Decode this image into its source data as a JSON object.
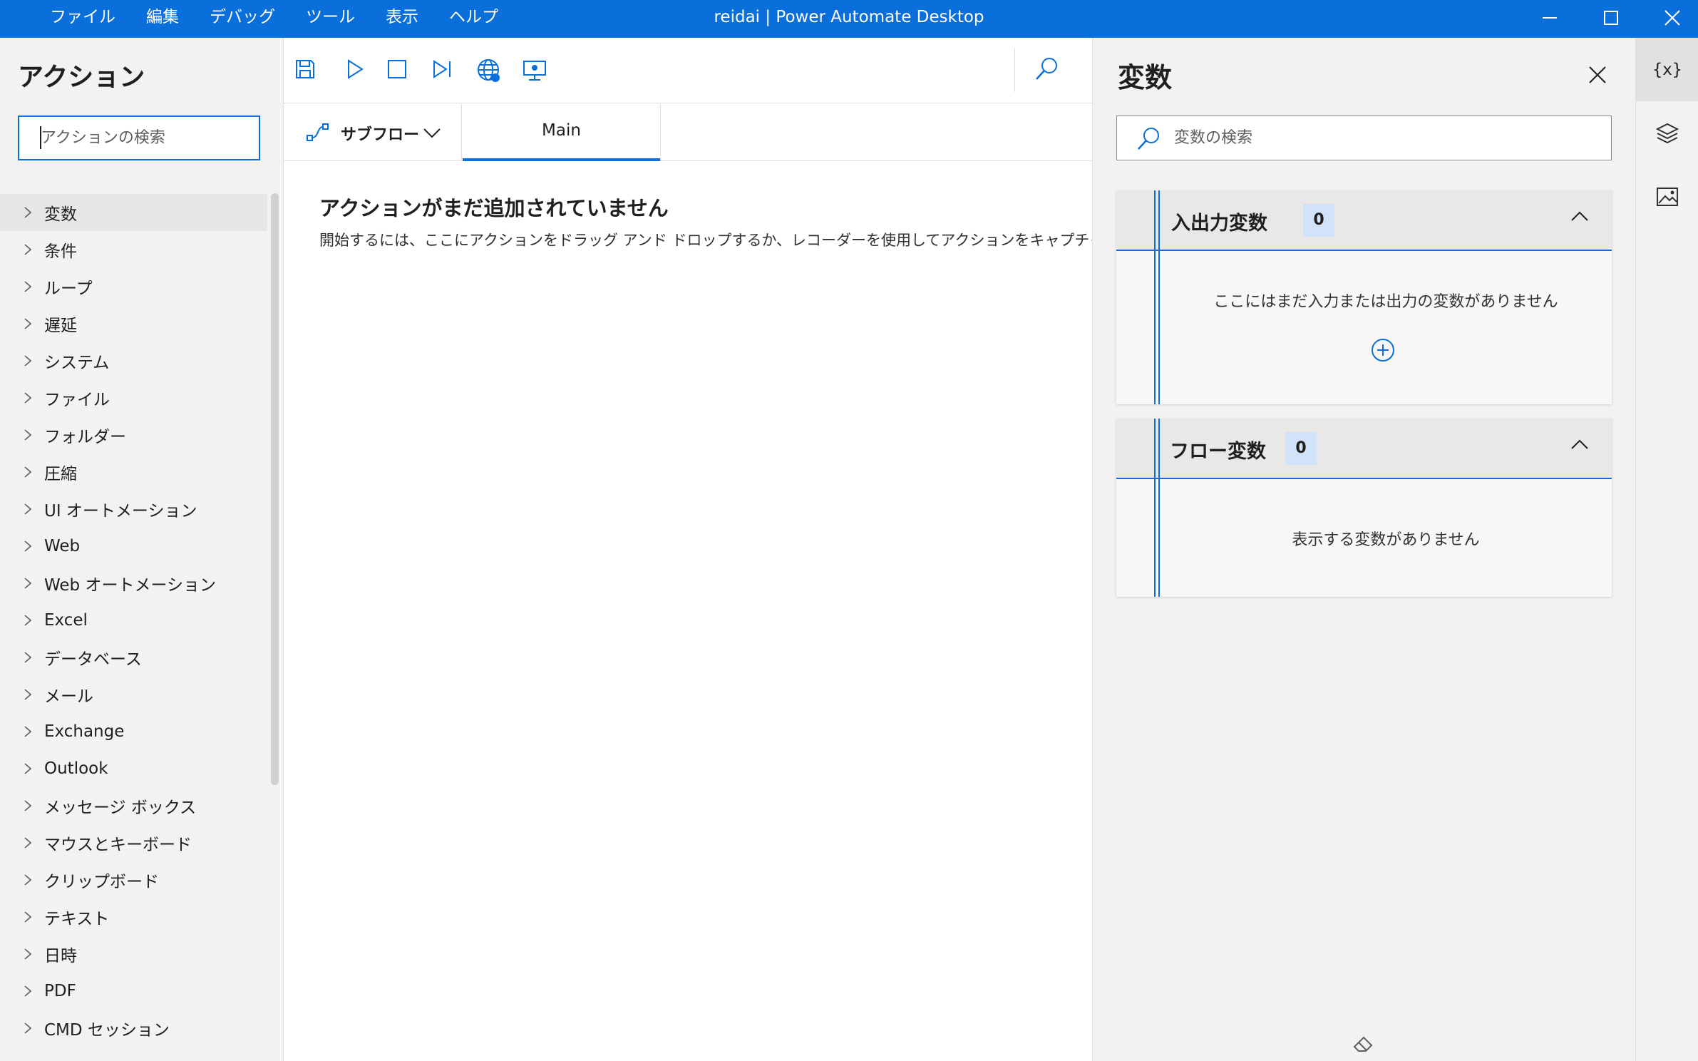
{
  "window": {
    "title": "reidai | Power Automate Desktop",
    "menu": [
      "ファイル",
      "編集",
      "デバッグ",
      "ツール",
      "表示",
      "ヘルプ"
    ]
  },
  "actions_panel": {
    "title": "アクション",
    "search_placeholder": "アクションの検索",
    "items": [
      {
        "label": "変数"
      },
      {
        "label": "条件"
      },
      {
        "label": "ループ"
      },
      {
        "label": "遅延"
      },
      {
        "label": "システム"
      },
      {
        "label": "ファイル"
      },
      {
        "label": "フォルダー"
      },
      {
        "label": "圧縮"
      },
      {
        "label": "UI オートメーション"
      },
      {
        "label": "Web"
      },
      {
        "label": "Web オートメーション"
      },
      {
        "label": "Excel"
      },
      {
        "label": "データベース"
      },
      {
        "label": "メール"
      },
      {
        "label": "Exchange"
      },
      {
        "label": "Outlook"
      },
      {
        "label": "メッセージ ボックス"
      },
      {
        "label": "マウスとキーボード"
      },
      {
        "label": "クリップボード"
      },
      {
        "label": "テキスト"
      },
      {
        "label": "日時"
      },
      {
        "label": "PDF"
      },
      {
        "label": "CMD セッション"
      }
    ]
  },
  "editor": {
    "subflow_label": "サブフロー",
    "main_tab": "Main",
    "empty_title": "アクションがまだ追加されていません",
    "empty_desc": "開始するには、ここにアクションをドラッグ アンド ドロップするか、レコーダーを使用してアクションをキャプチャします"
  },
  "variables_panel": {
    "title": "変数",
    "search_placeholder": "変数の検索",
    "io_section": {
      "title": "入出力変数",
      "count": "0",
      "empty": "ここにはまだ入力または出力の変数がありません"
    },
    "flow_section": {
      "title": "フロー変数",
      "count": "0",
      "empty": "表示する変数がありません"
    }
  },
  "rail": {
    "variables_label": "{x}"
  },
  "colors": {
    "accent": "#0a6edb",
    "panel_bg": "#f3f2f1",
    "badge_bg": "#d1e3f8"
  }
}
